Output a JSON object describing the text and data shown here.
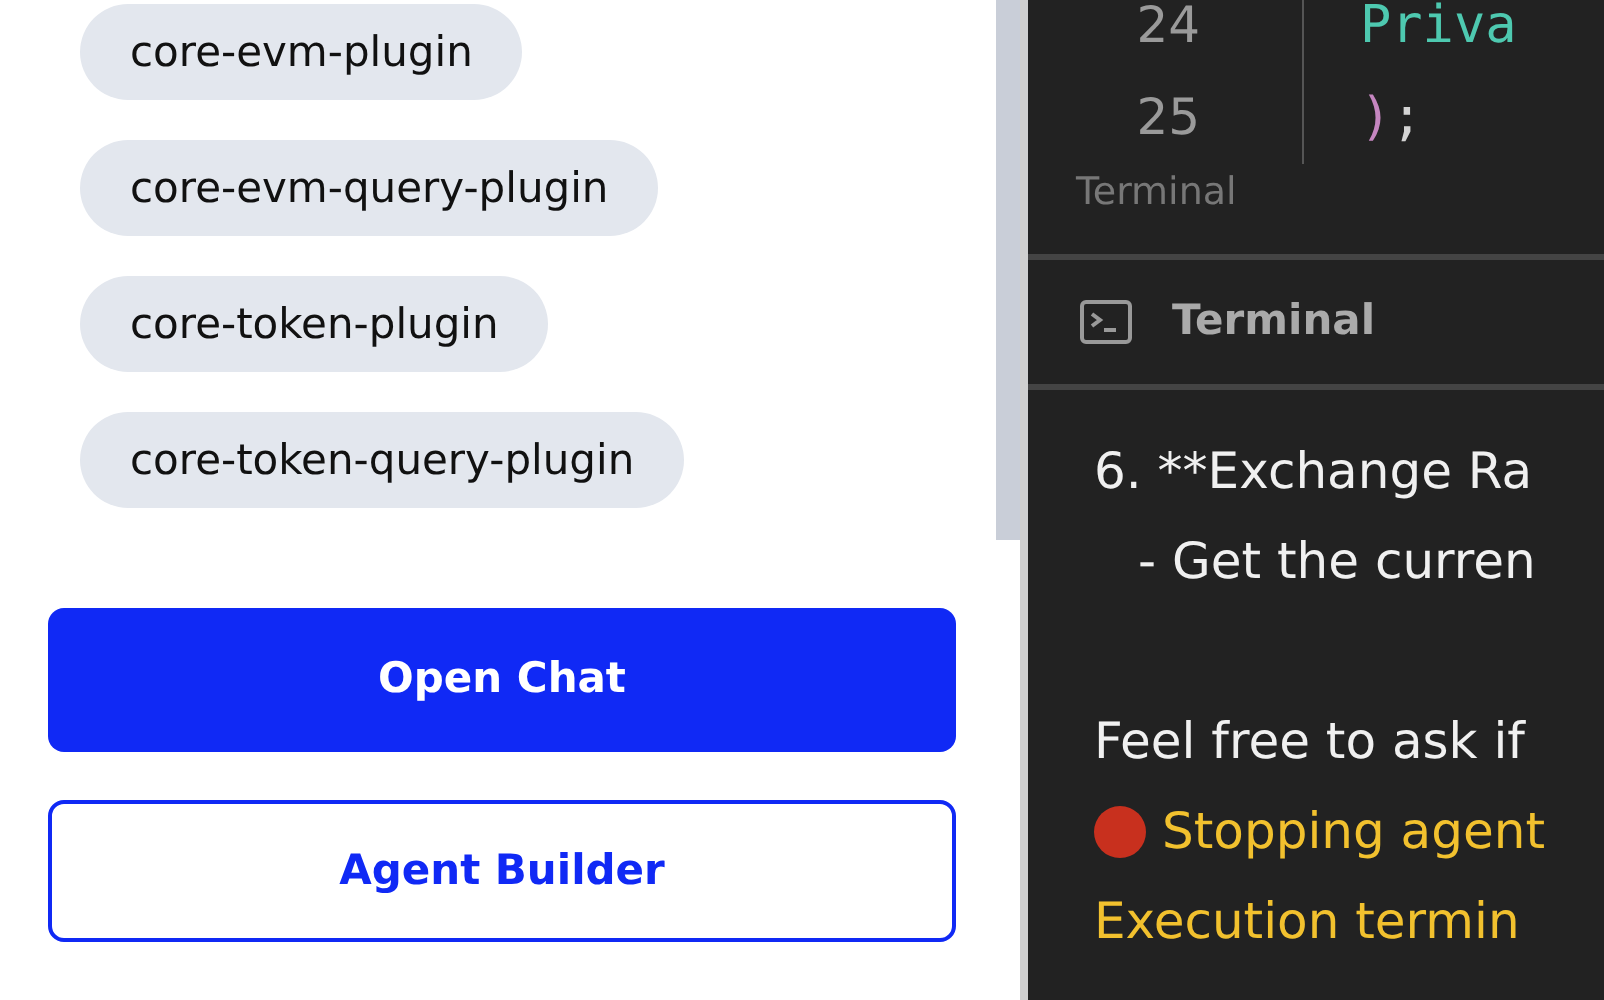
{
  "plugins": [
    {
      "label": "core-evm-plugin"
    },
    {
      "label": "core-evm-query-plugin"
    },
    {
      "label": "core-token-plugin"
    },
    {
      "label": "core-token-query-plugin"
    }
  ],
  "buttons": [
    {
      "label": "Open Chat",
      "kind": "primary"
    },
    {
      "label": "Agent Builder",
      "kind": "outline"
    }
  ],
  "code": {
    "lines": [
      {
        "number": "24",
        "tokens": [
          {
            "text": "Priva",
            "color": "#4ec9b0"
          }
        ]
      },
      {
        "number": "25",
        "tokens": [
          {
            "text": ")",
            "color": "#c586c0"
          },
          {
            "text": ";",
            "color": "#d4d4d4"
          }
        ]
      }
    ]
  },
  "code_caption": "Terminal",
  "terminal": {
    "title": "Terminal",
    "lines": [
      {
        "kind": "plain",
        "text": "6. **Exchange Ra"
      },
      {
        "kind": "indent",
        "text": "- Get the curren"
      },
      {
        "kind": "blank"
      },
      {
        "kind": "plain",
        "text": "Feel free to ask if"
      },
      {
        "kind": "warn-stop",
        "text": "Stopping agent"
      },
      {
        "kind": "warn",
        "text": "Execution termin"
      }
    ]
  }
}
